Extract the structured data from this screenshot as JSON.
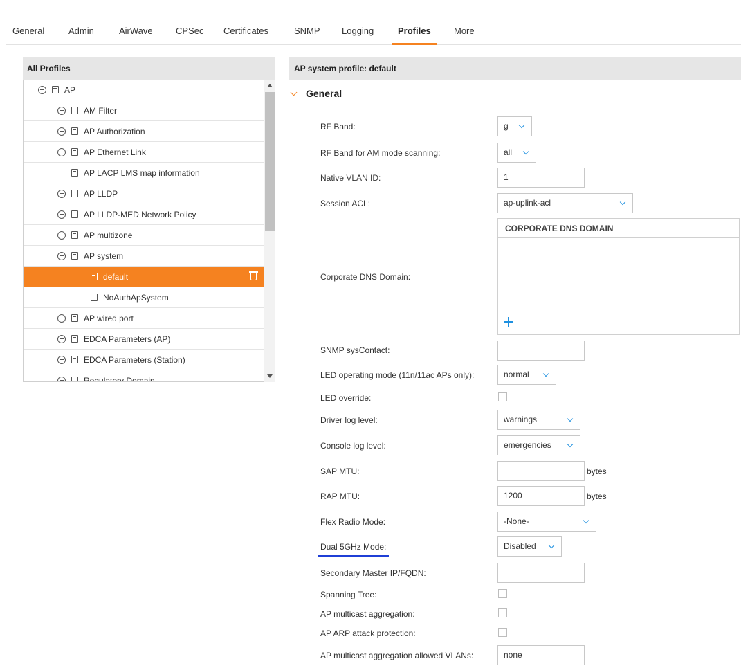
{
  "tabs": [
    "General",
    "Admin",
    "AirWave",
    "CPSec",
    "Certificates",
    "SNMP",
    "Logging",
    "Profiles",
    "More"
  ],
  "active_tab": "Profiles",
  "left_panel": {
    "header": "All Profiles",
    "items": [
      {
        "label": "AP",
        "expander": "minus"
      },
      {
        "label": "AM Filter",
        "expander": "plus"
      },
      {
        "label": "AP Authorization",
        "expander": "plus"
      },
      {
        "label": "AP Ethernet Link",
        "expander": "plus"
      },
      {
        "label": "AP LACP LMS map information",
        "expander": "none"
      },
      {
        "label": "AP LLDP",
        "expander": "plus"
      },
      {
        "label": "AP LLDP-MED Network Policy",
        "expander": "plus"
      },
      {
        "label": "AP multizone",
        "expander": "plus"
      },
      {
        "label": "AP system",
        "expander": "minus"
      },
      {
        "label": "default",
        "expander": "none",
        "selected": true
      },
      {
        "label": "NoAuthApSystem",
        "expander": "none"
      },
      {
        "label": "AP wired port",
        "expander": "plus"
      },
      {
        "label": "EDCA Parameters (AP)",
        "expander": "plus"
      },
      {
        "label": "EDCA Parameters (Station)",
        "expander": "plus"
      },
      {
        "label": "Regulatory Domain",
        "expander": "plus"
      }
    ]
  },
  "right_panel": {
    "header": "AP system profile: default",
    "section": "General",
    "fields": {
      "rf_band": {
        "label": "RF Band:",
        "value": "g"
      },
      "rf_band_am": {
        "label": "RF Band for AM mode scanning:",
        "value": "all"
      },
      "native_vlan": {
        "label": "Native VLAN ID:",
        "value": "1"
      },
      "session_acl": {
        "label": "Session ACL:",
        "value": "ap-uplink-acl"
      },
      "corp_dns": {
        "label": "Corporate DNS Domain:",
        "column_header": "CORPORATE DNS DOMAIN"
      },
      "snmp_contact": {
        "label": "SNMP sysContact:",
        "value": ""
      },
      "led_mode": {
        "label": "LED operating mode (11n/11ac APs only):",
        "value": "normal"
      },
      "led_override": {
        "label": "LED override:"
      },
      "driver_log": {
        "label": "Driver log level:",
        "value": "warnings"
      },
      "console_log": {
        "label": "Console log level:",
        "value": "emergencies"
      },
      "sap_mtu": {
        "label": "SAP MTU:",
        "value": "",
        "unit": "bytes"
      },
      "rap_mtu": {
        "label": "RAP MTU:",
        "value": "1200",
        "unit": "bytes"
      },
      "flex_radio": {
        "label": "Flex Radio Mode:",
        "value": "-None-"
      },
      "dual_5ghz": {
        "label": "Dual 5GHz Mode:",
        "value": "Disabled"
      },
      "secondary_master": {
        "label": "Secondary Master IP/FQDN:",
        "value": ""
      },
      "spanning_tree": {
        "label": "Spanning Tree:"
      },
      "multicast_agg": {
        "label": "AP multicast aggregation:"
      },
      "arp_protection": {
        "label": "AP ARP attack protection:"
      },
      "multicast_vlans": {
        "label": "AP multicast aggregation allowed VLANs:",
        "value": "none"
      }
    }
  },
  "colors": {
    "accent": "#f58220",
    "chevron": "#1e90e0",
    "underline": "#1f3fd6"
  }
}
